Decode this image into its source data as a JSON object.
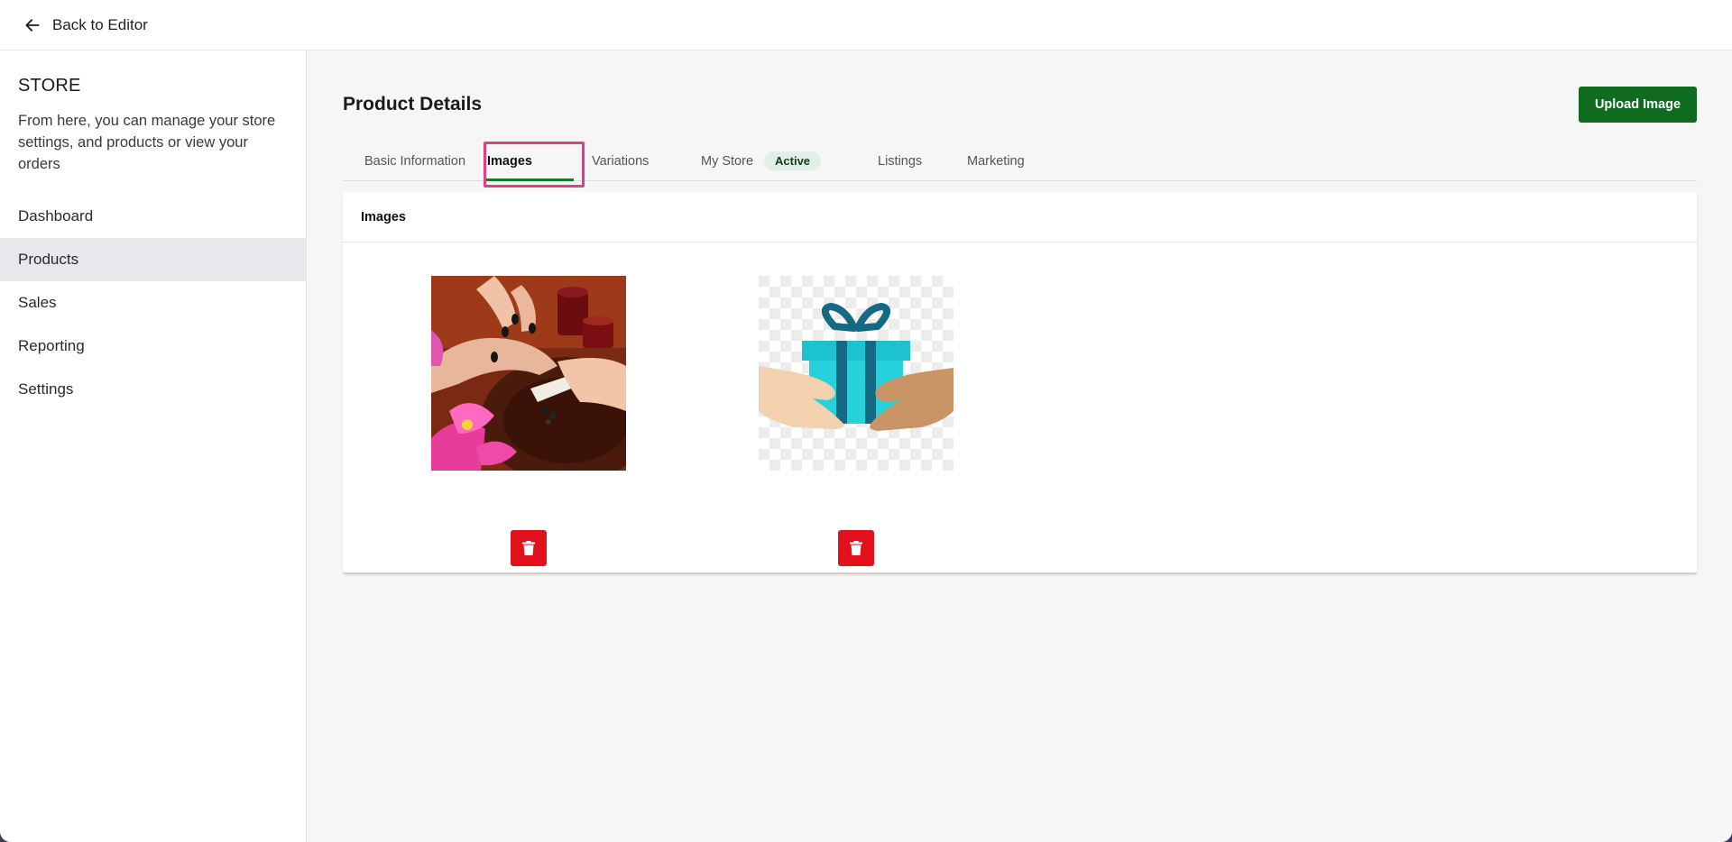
{
  "topbar": {
    "back_label": "Back to Editor"
  },
  "sidebar": {
    "title": "STORE",
    "description": "From here, you can manage your store settings, and products or view your orders",
    "items": [
      {
        "label": "Dashboard",
        "active": false
      },
      {
        "label": "Products",
        "active": true
      },
      {
        "label": "Sales",
        "active": false
      },
      {
        "label": "Reporting",
        "active": false
      },
      {
        "label": "Settings",
        "active": false
      }
    ]
  },
  "main": {
    "title": "Product Details",
    "upload_label": "Upload Image",
    "tabs": [
      {
        "label": "Basic Information"
      },
      {
        "label": "Images",
        "active": true
      },
      {
        "label": "Variations"
      },
      {
        "label": "My Store",
        "badge": "Active"
      },
      {
        "label": "Listings"
      },
      {
        "label": "Marketing"
      }
    ],
    "images_card": {
      "title": "Images",
      "images": [
        {
          "name": "manicure-photo"
        },
        {
          "name": "gift-box-illustration"
        }
      ]
    }
  },
  "colors": {
    "primary": "#0f6b1f",
    "tab_underline": "#1a7a2a",
    "highlight": "#e33d86",
    "delete": "#e3111b",
    "badge_bg": "#e3efe6"
  }
}
